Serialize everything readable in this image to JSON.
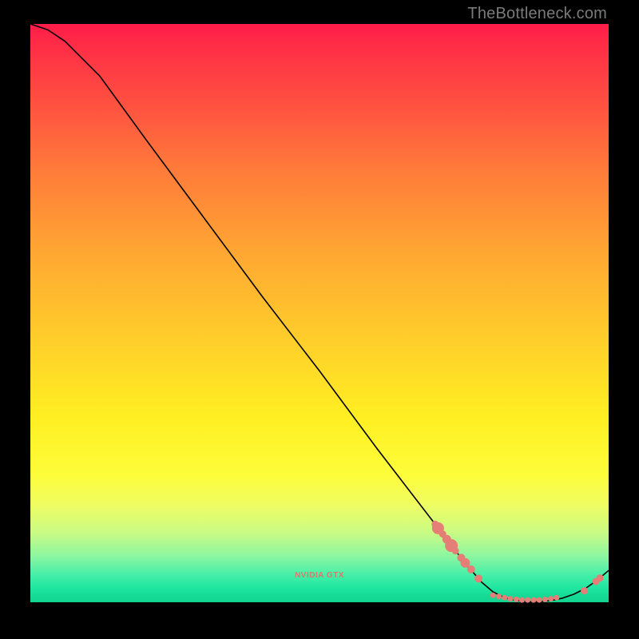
{
  "watermark": "TheBottleneck.com",
  "chart_data": {
    "type": "line",
    "title": "",
    "xlabel": "",
    "ylabel": "",
    "xlim": [
      0,
      100
    ],
    "ylim": [
      0,
      100
    ],
    "series": [
      {
        "name": "bottleneck-curve",
        "x": [
          0,
          3,
          6,
          9,
          12,
          20,
          30,
          40,
          50,
          60,
          70,
          75,
          78,
          80,
          82,
          84,
          86,
          88,
          90,
          92,
          94,
          96,
          98,
          100
        ],
        "values": [
          100,
          99,
          97,
          94,
          91,
          80,
          66.5,
          53,
          40,
          26.5,
          13.5,
          7,
          3.5,
          1.8,
          0.8,
          0.3,
          0.1,
          0.1,
          0.3,
          0.7,
          1.4,
          2.4,
          3.8,
          5.5
        ]
      }
    ],
    "markers_cluster_left": {
      "x": [
        70.0,
        70.5,
        71.3,
        72.0,
        72.8,
        73.5,
        74.5,
        75.2,
        76.2,
        77.5
      ],
      "y": [
        13.5,
        12.8,
        11.8,
        10.9,
        9.8,
        8.9,
        7.7,
        6.8,
        5.7,
        4.1
      ],
      "size": [
        4.5,
        7.5,
        4.5,
        5.5,
        8.0,
        4.5,
        5.0,
        6.0,
        5.0,
        5.0
      ]
    },
    "markers_bottom": {
      "x": [
        80.0,
        81.0,
        82.0,
        83.0,
        84.0,
        85.0,
        86.0,
        87.0,
        88.0,
        89.0,
        90.0,
        91.0
      ],
      "y": [
        1.2,
        1.0,
        0.8,
        0.6,
        0.5,
        0.4,
        0.4,
        0.4,
        0.4,
        0.5,
        0.6,
        0.8
      ],
      "size": 3.5
    },
    "markers_right": {
      "x": [
        95.8,
        97.8,
        98.5
      ],
      "y": [
        2.0,
        3.6,
        4.2
      ],
      "size": [
        4.5,
        4.5,
        4.5
      ]
    },
    "marker_color": "#e57e77",
    "marker_black_stroke": false,
    "curve_color": "#000000",
    "bottom_label": "NVIDIA GTX"
  }
}
